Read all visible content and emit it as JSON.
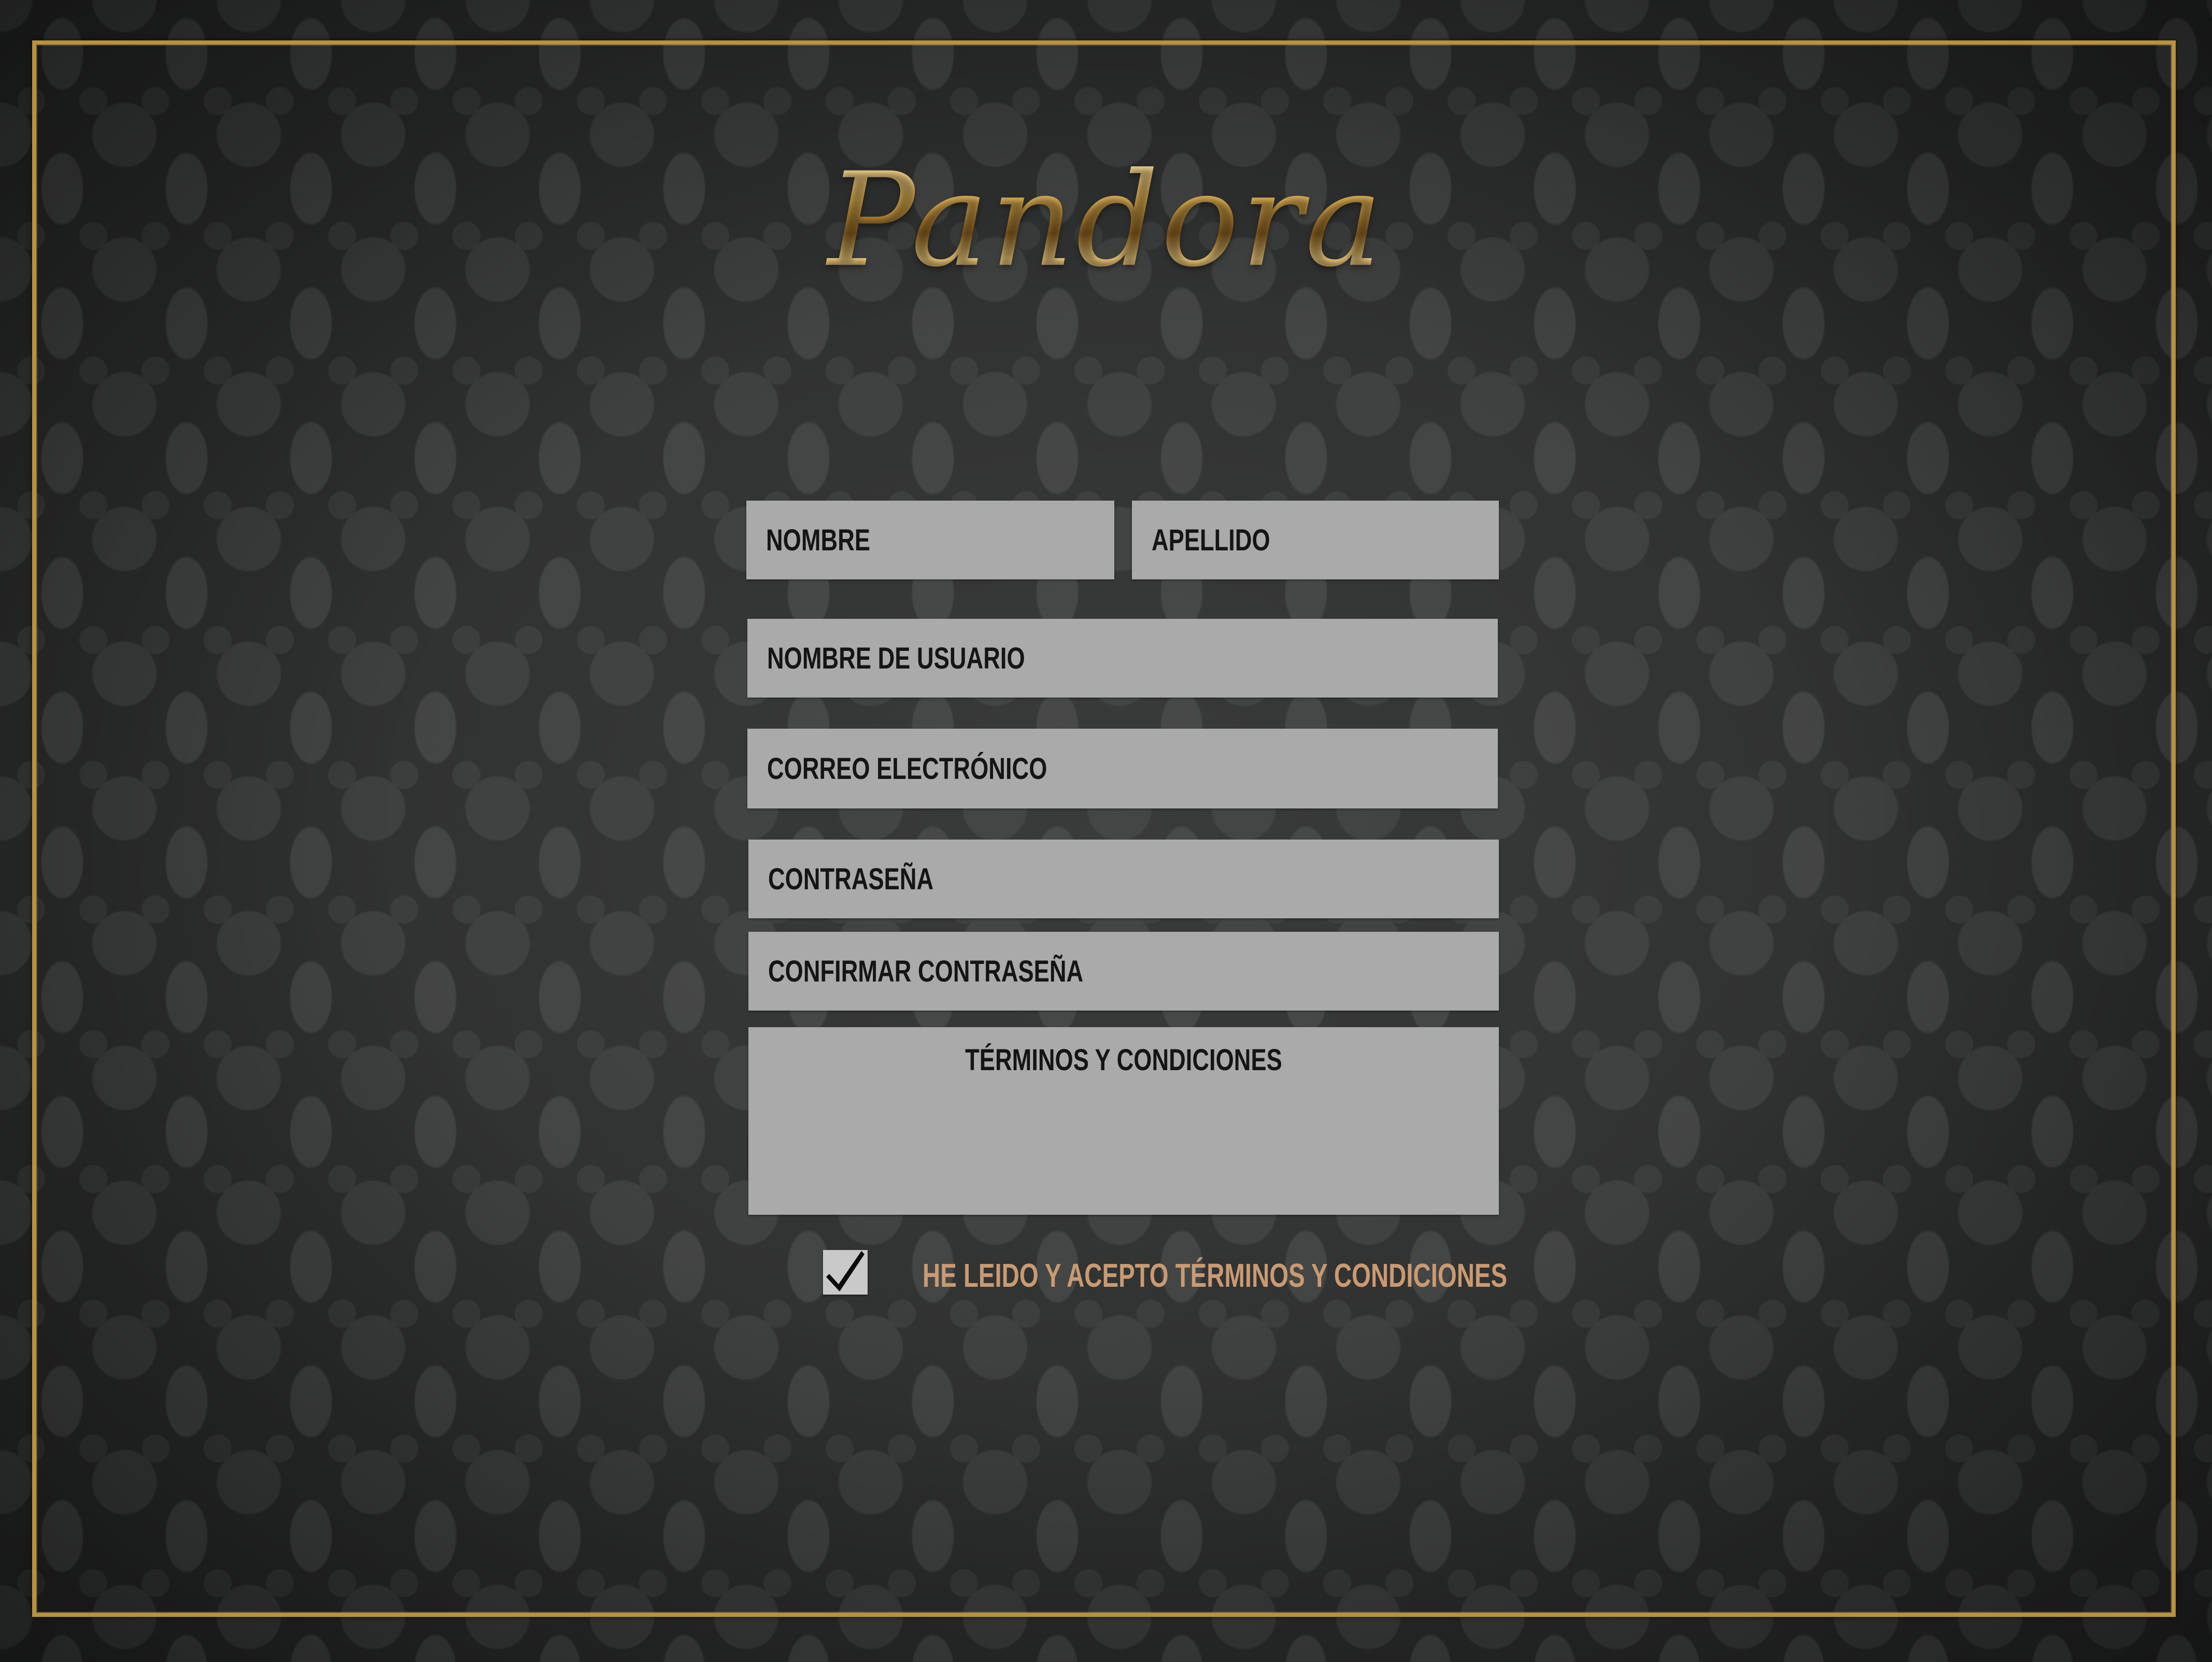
{
  "app": {
    "logo_text": "Pandora"
  },
  "form": {
    "first_name_placeholder": "NOMBRE",
    "last_name_placeholder": "APELLIDO",
    "username_placeholder": "NOMBRE DE USUARIO",
    "email_placeholder": "CORREO ELECTRÓNICO",
    "password_placeholder": "CONTRASEÑA",
    "confirm_password_placeholder": "CONFIRMAR CONTRASEÑA",
    "terms_title": "TÉRMINOS Y CONDICIONES",
    "accept_checked": true,
    "accept_label": "HE LEIDO Y ACEPTO TÉRMINOS Y CONDICIONES"
  },
  "colors": {
    "background": "#2b2c2c",
    "frame_gold": "#b8923f",
    "field_bg": "#a9aaa9",
    "accept_text": "#c99a72"
  },
  "icons": {
    "checkbox_mark": "checkmark-icon"
  }
}
